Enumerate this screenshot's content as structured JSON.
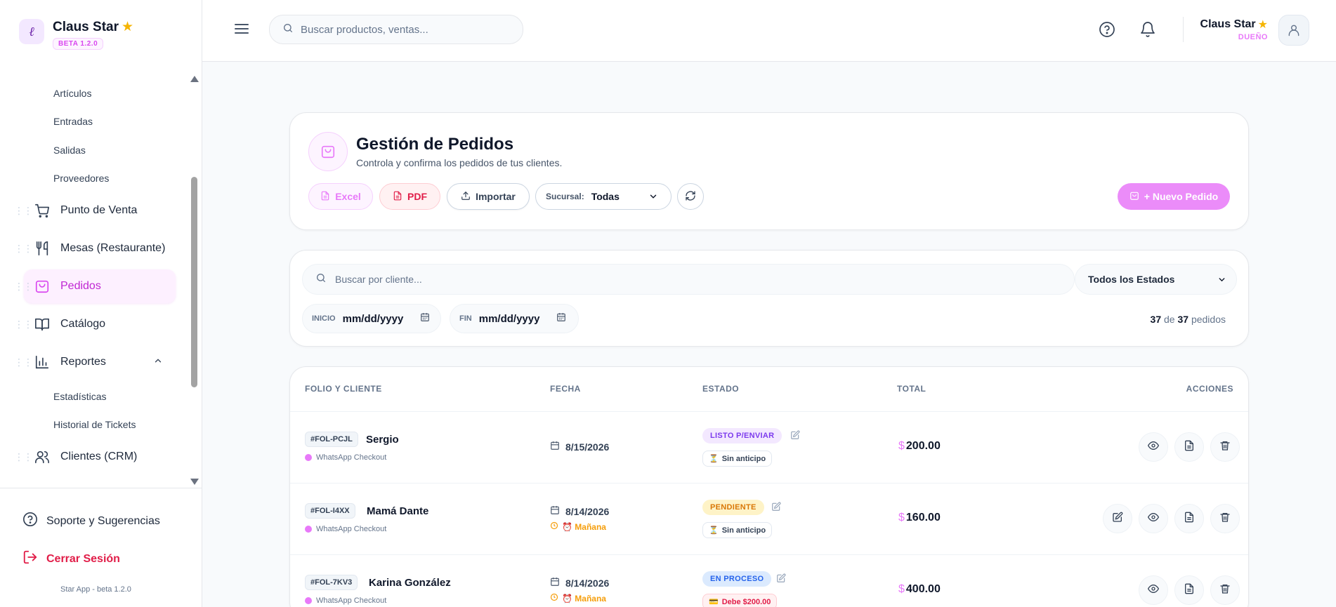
{
  "sidebar": {
    "brand_name": "Claus Star",
    "brand_beta": "BETA 1.2.0",
    "sub_items_top": [
      "Artículos",
      "Entradas",
      "Salidas",
      "Proveedores"
    ],
    "items": [
      {
        "label": "Punto de Venta",
        "icon": "cart-icon"
      },
      {
        "label": "Mesas (Restaurante)",
        "icon": "utensils-icon"
      },
      {
        "label": "Pedidos",
        "icon": "shopping-bag-icon",
        "active": true
      },
      {
        "label": "Catálogo",
        "icon": "book-icon"
      },
      {
        "label": "Reportes",
        "icon": "bar-chart-icon"
      },
      {
        "label": "Clientes (CRM)",
        "icon": "users-icon"
      }
    ],
    "reportes_sub": [
      "Estadísticas",
      "Historial de Tickets"
    ],
    "support": "Soporte y Sugerencias",
    "logout": "Cerrar Sesión",
    "version": "Star App - beta 1.2.0"
  },
  "header": {
    "search_placeholder": "Buscar productos, ventas...",
    "user_name": "Claus Star",
    "user_role": "DUEÑO"
  },
  "page": {
    "title": "Gestión de Pedidos",
    "subtitle": "Controla y confirma los pedidos de tus clientes.",
    "buttons": {
      "excel": "Excel",
      "pdf": "PDF",
      "import": "Importar",
      "new_order": "+ Nuevo Pedido"
    },
    "sucursal_label": "Sucursal:",
    "sucursal_value": "Todas"
  },
  "filters": {
    "search_placeholder": "Buscar por cliente...",
    "status_value": "Todos los Estados",
    "start_label": "INICIO",
    "start_value": "mm/dd/yyyy",
    "end_label": "FIN",
    "end_value": "mm/dd/yyyy",
    "count_shown": "37",
    "count_of": "de",
    "count_total": "37",
    "count_unit": "pedidos"
  },
  "table": {
    "headers": {
      "folio": "FOLIO Y CLIENTE",
      "date": "FECHA",
      "status": "ESTADO",
      "total": "TOTAL",
      "actions": "ACCIONES"
    },
    "rows": [
      {
        "folio": "#FOL-PCJL",
        "client": "Sergio",
        "origin": "WhatsApp Checkout",
        "date": "8/15/2026",
        "due": "",
        "status": "LISTO P/ENVIAR",
        "status_fg": "#7c3aed",
        "status_bg": "#f3e8ff",
        "payment": "Sin anticipo",
        "payment_icon": "⏳",
        "total_currency": "$",
        "total": "200.00"
      },
      {
        "folio": "#FOL-I4XX",
        "client": "Mamá Dante",
        "origin": "WhatsApp Checkout",
        "date": "8/14/2026",
        "due": "⏰ Mañana",
        "status": "PENDIENTE",
        "status_fg": "#d97706",
        "status_bg": "#fef3c7",
        "payment": "Sin anticipo",
        "payment_icon": "⏳",
        "total_currency": "$",
        "total": "160.00"
      },
      {
        "folio": "#FOL-7KV3",
        "client": "Karina González",
        "origin": "WhatsApp Checkout",
        "date": "8/14/2026",
        "due": "⏰ Mañana",
        "status": "EN PROCESO",
        "status_fg": "#2563eb",
        "status_bg": "#dbeafe",
        "payment": "Debe $200.00",
        "payment_icon": "💳",
        "total_currency": "$",
        "total": "400.00"
      }
    ]
  }
}
